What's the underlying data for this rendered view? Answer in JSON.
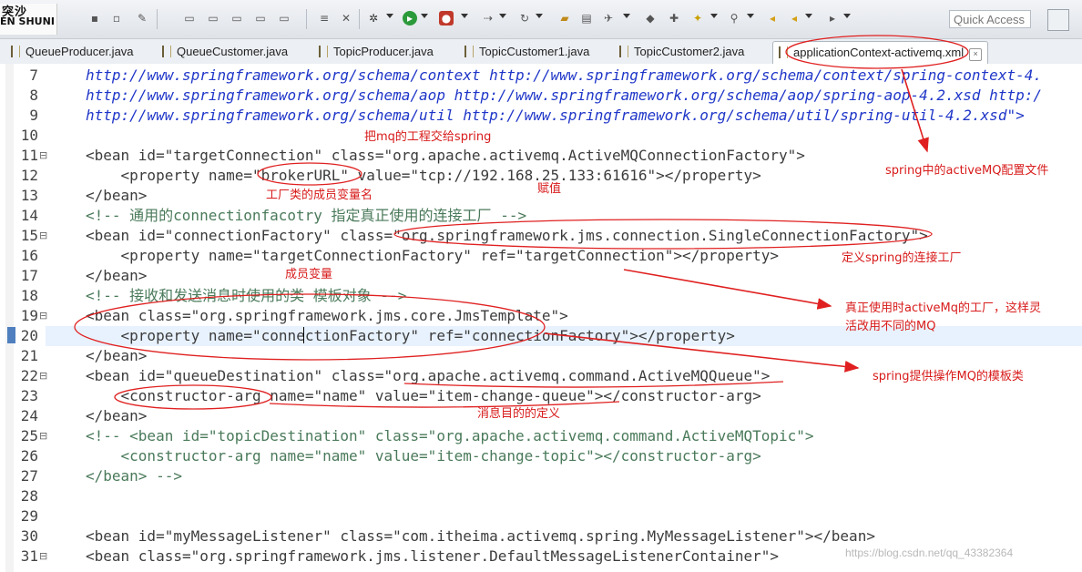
{
  "toolbar": {
    "logo_line1": "突沙",
    "logo_line2": "EN SHUNI",
    "quick_access_placeholder": "Quick Access",
    "icons": [
      "save-icon",
      "print-icon",
      "new-icon",
      "run-icon",
      "debug-icon",
      "search-icon",
      "settings-icon",
      "back-icon",
      "forward-icon"
    ]
  },
  "tabs": [
    {
      "label": "QueueProducer.java",
      "active": false
    },
    {
      "label": "QueueCustomer.java",
      "active": false
    },
    {
      "label": "TopicProducer.java",
      "active": false
    },
    {
      "label": "TopicCustomer1.java",
      "active": false
    },
    {
      "label": "TopicCustomer2.java",
      "active": false
    },
    {
      "label": "applicationContext-activemq.xml",
      "active": true
    }
  ],
  "editor": {
    "lines": [
      {
        "n": "7",
        "text": "http://www.springframework.org/schema/context http://www.springframework.org/schema/context/spring-context-4."
      },
      {
        "n": "8",
        "text": "http://www.springframework.org/schema/aop http://www.springframework.org/schema/aop/spring-aop-4.2.xsd http:/"
      },
      {
        "n": "9",
        "text": "http://www.springframework.org/schema/util http://www.springframework.org/schema/util/spring-util-4.2.xsd\">"
      },
      {
        "n": "10",
        "text": ""
      },
      {
        "n": "11",
        "text": "<bean id=\"targetConnection\" class=\"org.apache.activemq.ActiveMQConnectionFactory\">"
      },
      {
        "n": "12",
        "text": "    <property name=\"brokerURL\" value=\"tcp://192.168.25.133:61616\"></property>"
      },
      {
        "n": "13",
        "text": "</bean>"
      },
      {
        "n": "14",
        "text": "<!-- 通用的connectionfacotry 指定真正使用的连接工厂 -->"
      },
      {
        "n": "15",
        "text": "<bean id=\"connectionFactory\" class=\"org.springframework.jms.connection.SingleConnectionFactory\">"
      },
      {
        "n": "16",
        "text": "    <property name=\"targetConnectionFactory\" ref=\"targetConnection\"></property>"
      },
      {
        "n": "17",
        "text": "</bean>"
      },
      {
        "n": "18",
        "text": "<!-- 接收和发送消息时使用的类 模板对象 -->"
      },
      {
        "n": "19",
        "text": "<bean class=\"org.springframework.jms.core.JmsTemplate\">"
      },
      {
        "n": "20",
        "text": "    <property name=\"connectionFactory\" ref=\"connectionFactory\"></property>"
      },
      {
        "n": "21",
        "text": "</bean>"
      },
      {
        "n": "22",
        "text": "<bean id=\"queueDestination\" class=\"org.apache.activemq.command.ActiveMQQueue\">"
      },
      {
        "n": "23",
        "text": "    <constructor-arg name=\"name\" value=\"item-change-queue\"></constructor-arg>"
      },
      {
        "n": "24",
        "text": "</bean>"
      },
      {
        "n": "25",
        "text": "<!-- <bean id=\"topicDestination\" class=\"org.apache.activemq.command.ActiveMQTopic\">"
      },
      {
        "n": "26",
        "text": "    <constructor-arg name=\"name\" value=\"item-change-topic\"></constructor-arg>"
      },
      {
        "n": "27",
        "text": "</bean> -->"
      },
      {
        "n": "28",
        "text": ""
      },
      {
        "n": "29",
        "text": ""
      },
      {
        "n": "30",
        "text": "<bean id=\"myMessageListener\" class=\"com.itheima.activemq.spring.MyMessageListener\"></bean>"
      },
      {
        "n": "31",
        "text": "<bean class=\"org.springframework.jms.listener.DefaultMessageListenerContainer\">"
      }
    ]
  },
  "annotations": {
    "a1": "把mq的工程交给spring",
    "a2": "spring中的activeMQ配置文件",
    "a3": "工厂类的成员变量名",
    "a4": "赋值",
    "a5": "定义spring的连接工厂",
    "a6": "成员变量",
    "a7_line1": "真正使用时activeMq的工厂，这样灵",
    "a7_line2": "活改用不同的MQ",
    "a8": "spring提供操作MQ的模板类",
    "a9": "消息目的的定义"
  },
  "watermark": "https://blog.csdn.net/qq_43382364"
}
